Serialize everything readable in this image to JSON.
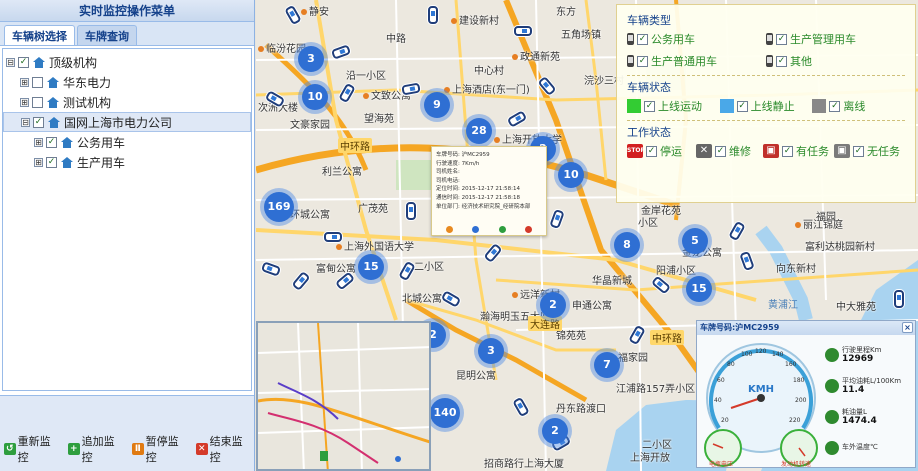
{
  "left": {
    "title": "实时监控操作菜单",
    "tabs": [
      {
        "label": "车辆树选择"
      },
      {
        "label": "车牌查询"
      }
    ],
    "tree": [
      {
        "label": "顶级机构",
        "expander": "⊟",
        "check": "✓"
      },
      {
        "label": "华东电力",
        "expander": "⊞",
        "check": ""
      },
      {
        "label": "测试机构",
        "expander": "⊞",
        "check": ""
      },
      {
        "label": "国网上海市电力公司",
        "expander": "⊟",
        "check": "✓"
      },
      {
        "label": "公务用车",
        "expander": "⊞",
        "check": "✓"
      },
      {
        "label": "生产用车",
        "expander": "⊞",
        "check": "✓"
      }
    ],
    "buttons": [
      {
        "label": "重新监控",
        "color": "#2e9e3e",
        "glyph": "↺"
      },
      {
        "label": "追加监控",
        "color": "#2e9e3e",
        "glyph": "+"
      },
      {
        "label": "暂停监控",
        "color": "#e07a12",
        "glyph": "Ⅱ"
      },
      {
        "label": "结束监控",
        "color": "#d43a2a",
        "glyph": "✕"
      }
    ]
  },
  "map": {
    "pois": [
      {
        "name": "静安"
      },
      {
        "name": "建设新村"
      },
      {
        "name": "五角场镇"
      },
      {
        "name": "临汾花园"
      },
      {
        "name": "中路"
      },
      {
        "name": "政通新苑"
      },
      {
        "name": "沿一小区"
      },
      {
        "name": "中心村"
      },
      {
        "name": "浣沙三村"
      },
      {
        "name": "次洲大楼"
      },
      {
        "name": "文致公寓"
      },
      {
        "name": "上海酒店(东一门)"
      },
      {
        "name": "文豪家园"
      },
      {
        "name": "望海苑"
      },
      {
        "name": "上海开放大学"
      },
      {
        "name": "利兰公寓"
      },
      {
        "name": "环城公寓"
      },
      {
        "name": "广茂苑"
      },
      {
        "name": "上海外国语大学"
      },
      {
        "name": "富甸公寓"
      },
      {
        "name": "二小区"
      },
      {
        "name": "北城公寓"
      },
      {
        "name": "远洋新村"
      },
      {
        "name": "瀚海明玉五大厦"
      },
      {
        "name": "锦苑苑"
      },
      {
        "name": "昆明公寓"
      },
      {
        "name": "福家园"
      },
      {
        "name": "江浦路157弄小区"
      },
      {
        "name": "丹东路渡口"
      },
      {
        "name": "招商路行上海大厦"
      },
      {
        "name": "丽江锦庭"
      },
      {
        "name": "富利达桃园新村"
      },
      {
        "name": "向东新村"
      },
      {
        "name": "中大雅苑"
      },
      {
        "name": "金龙公寓"
      },
      {
        "name": "华晶新城"
      },
      {
        "name": "小区"
      },
      {
        "name": "申通公寓"
      },
      {
        "name": "阳浦小区"
      },
      {
        "name": "福园"
      },
      {
        "name": "二小区"
      },
      {
        "name": "上海开放"
      },
      {
        "name": "金岸花苑"
      },
      {
        "name": "东方"
      }
    ],
    "roads": [
      {
        "name": "中环路"
      },
      {
        "name": "大连路"
      },
      {
        "name": "中环路"
      },
      {
        "name": "黄浦江"
      }
    ],
    "clusters": [
      {
        "count": "3"
      },
      {
        "count": "10"
      },
      {
        "count": "9"
      },
      {
        "count": "28"
      },
      {
        "count": "2"
      },
      {
        "count": "10"
      },
      {
        "count": "169"
      },
      {
        "count": "15"
      },
      {
        "count": "2"
      },
      {
        "count": "3"
      },
      {
        "count": "8"
      },
      {
        "count": "5"
      },
      {
        "count": "15"
      },
      {
        "count": "2"
      },
      {
        "count": "7"
      },
      {
        "count": "140"
      },
      {
        "count": "2"
      }
    ]
  },
  "popup": {
    "rows": [
      "车牌号码: 沪MC2959",
      "行驶速度: 7Km/h",
      "司机姓名:",
      "司机电话:",
      "定位时间: 2015-12-17 21:58:14",
      "通信时间: 2015-12-17 21:58:18",
      "单位部门: 经济技术研究院_经研院本部"
    ]
  },
  "legend": {
    "type_title": "车辆类型",
    "types": [
      "公务用车",
      "生产管理用车",
      "生产普通用车",
      "其他"
    ],
    "status_title": "车辆状态",
    "statuses": [
      {
        "label": "上线运动",
        "color": "#33cc33"
      },
      {
        "label": "上线静止",
        "color": "#4aa8e8"
      },
      {
        "label": "离线",
        "color": "#888888"
      }
    ],
    "work_title": "工作状态",
    "works": [
      {
        "label": "停运",
        "color": "#d22020",
        "glyph": "STOP"
      },
      {
        "label": "维修",
        "color": "#666666",
        "glyph": "✕"
      },
      {
        "label": "有任务",
        "color": "#c0302a",
        "glyph": "▣"
      },
      {
        "label": "无任务",
        "color": "#7a7a7a",
        "glyph": "▣"
      }
    ]
  },
  "dashboard": {
    "title": "车牌号码:沪MC2959",
    "close": "×",
    "gauge_unit": "KMH",
    "gauge_ticks": [
      "20",
      "40",
      "60",
      "80",
      "100",
      "120",
      "140",
      "160",
      "180",
      "200",
      "220"
    ],
    "left_gauge_label": "电瓶电压",
    "right_gauge_label": "发动机转速",
    "items": [
      {
        "label": "行驶里程Km",
        "value": "12969"
      },
      {
        "label": "平均油耗L/100Km",
        "value": "11.4"
      },
      {
        "label": "耗油量L",
        "value": "1474.4"
      },
      {
        "label": "车外温度℃",
        "value": ""
      }
    ]
  }
}
